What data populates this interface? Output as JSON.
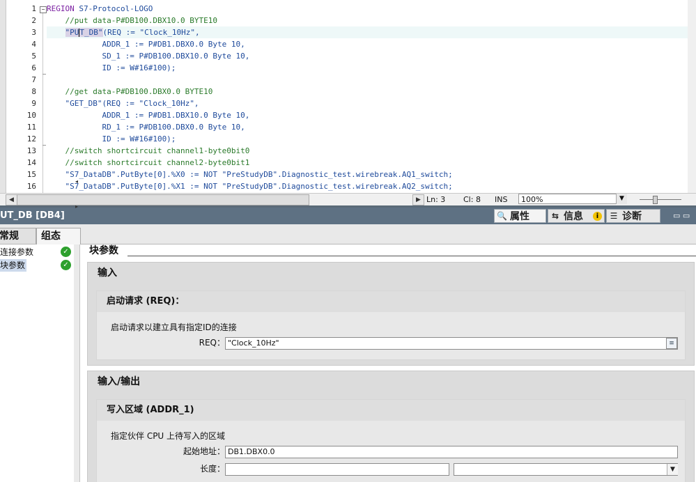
{
  "editor": {
    "lines": [
      {
        "num": "1",
        "pre": "",
        "kw": "REGION",
        "rest": " S7-Protocol-LOGO",
        "cls": "kw"
      },
      {
        "num": "2",
        "text": "    //put data-P#DB100.DBX10.0 BYTE10",
        "cls": "cm"
      },
      {
        "num": "3",
        "fb_pre": "\"PU",
        "fb_post": "T_DB\"",
        "rest": "(REQ := \"Clock_10Hz\","
      },
      {
        "num": "4",
        "text": "            ADDR_1 := P#DB1.DBX0.0 Byte 10,"
      },
      {
        "num": "5",
        "text": "            SD_1 := P#DB100.DBX10.0 Byte 10,"
      },
      {
        "num": "6",
        "text": "            ID := W#16#100);"
      },
      {
        "num": "7",
        "text": ""
      },
      {
        "num": "8",
        "text": "    //get data-P#DB100.DBX0.0 BYTE10",
        "cls": "cm"
      },
      {
        "num": "9",
        "fb": "\"GET_DB\"",
        "rest": "(REQ := \"Clock_10Hz\","
      },
      {
        "num": "10",
        "text": "            ADDR_1 := P#DB1.DBX10.0 Byte 10,"
      },
      {
        "num": "11",
        "text": "            RD_1 := P#DB100.DBX0.0 Byte 10,"
      },
      {
        "num": "12",
        "text": "            ID := W#16#100);"
      },
      {
        "num": "13",
        "text": "    //switch shortcircuit channel1-byte0bit0",
        "cls": "cm"
      },
      {
        "num": "14",
        "text": "    //switch shortcircuit channel2-byte0bit1",
        "cls": "cm"
      },
      {
        "num": "15",
        "text": "    \"S7_DataDB\".PutByte[0].%X0 := NOT \"PreStudyDB\".Diagnostic_test.wirebreak.AQ1_switch;"
      },
      {
        "num": "16",
        "text": "    \"S7_DataDB\".PutByte[0].%X1 := NOT \"PreStudyDB\".Diagnostic_test.wirebreak.AQ2_switch;"
      }
    ],
    "status": {
      "ln": "Ln: 3",
      "col": "Cl: 8",
      "mode": "INS",
      "zoom": "100%"
    }
  },
  "inspector": {
    "title": "UT_DB [DB4]",
    "tabs": [
      {
        "label": "属性"
      },
      {
        "label": "信息"
      },
      {
        "label": "诊断"
      }
    ],
    "subtabs": [
      {
        "label": "常规"
      },
      {
        "label": "组态"
      }
    ],
    "tree": [
      {
        "label": "连接参数"
      },
      {
        "label": "块参数"
      }
    ],
    "block_title": "块参数",
    "input_group": {
      "title": "输入",
      "req": {
        "title": "启动请求 (REQ)：",
        "desc": "启动请求以建立具有指定ID的连接",
        "label": "REQ：",
        "value": "\"Clock_10Hz\""
      }
    },
    "io_group": {
      "title": "输入/输出",
      "addr": {
        "title": "写入区域 (ADDR_1)",
        "desc": "指定伙伴 CPU 上待写入的区域",
        "start_label": "起始地址：",
        "start_value": "DB1.DBX0.0",
        "len_label": "长度：",
        "len_value": "",
        "unit_value": ""
      }
    }
  }
}
